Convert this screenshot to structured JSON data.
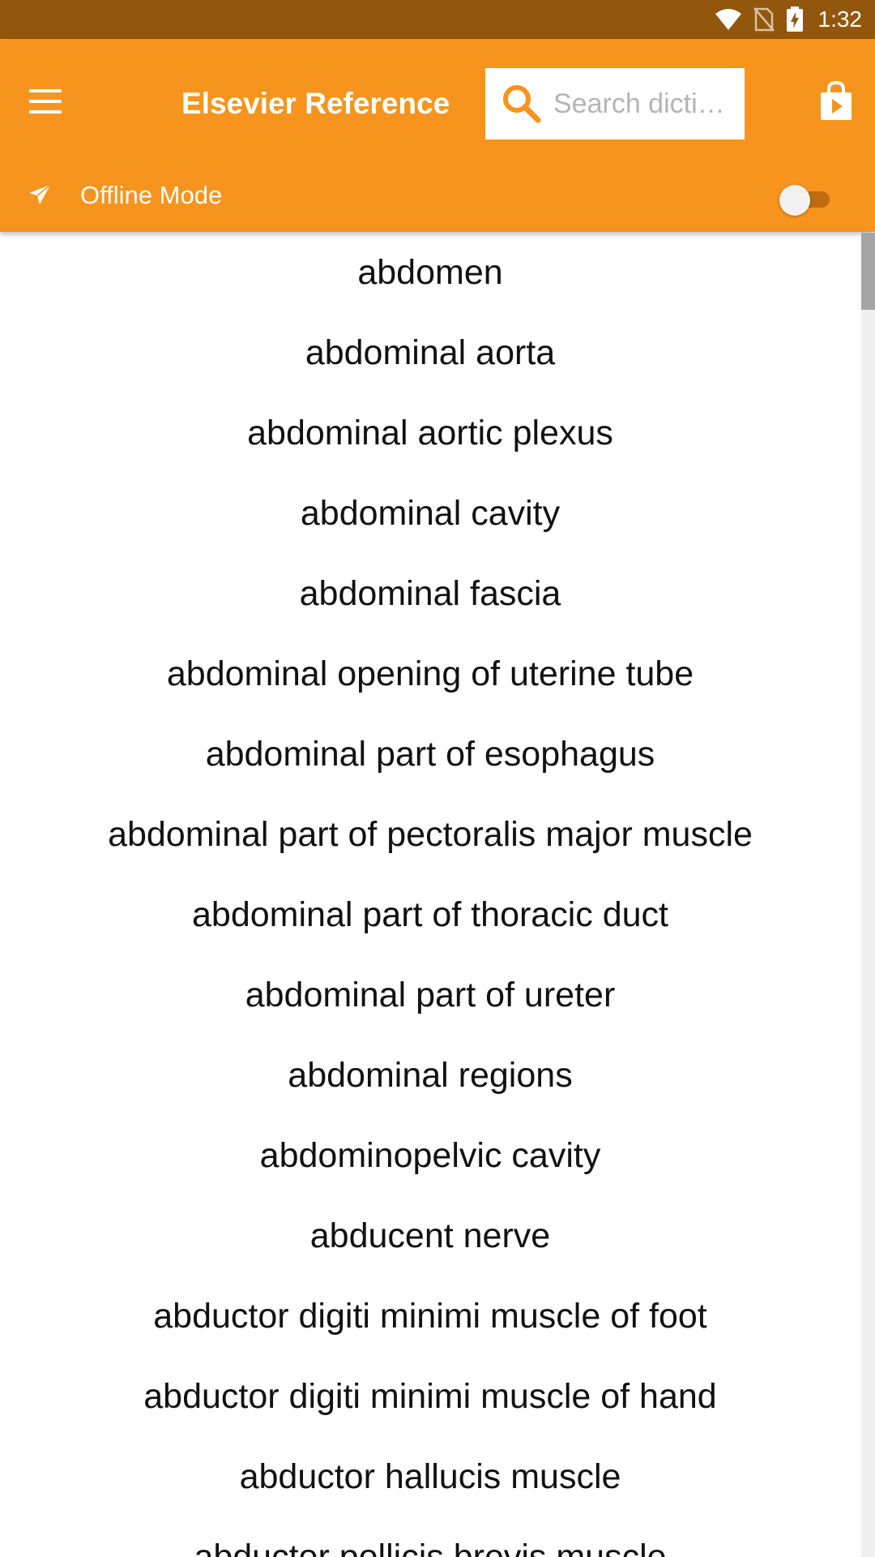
{
  "status_bar": {
    "time": "1:32",
    "icons": [
      "wifi-icon",
      "no-sim-icon",
      "battery-charging-icon"
    ]
  },
  "app_bar": {
    "title": "Elsevier Reference",
    "menu_icon": "hamburger-menu-icon",
    "search": {
      "placeholder": "Search dicti…",
      "value": "",
      "icon": "search-icon"
    },
    "store_icon": "shopping-bag-play-icon"
  },
  "offline": {
    "icon": "airplane-icon",
    "label": "Offline Mode",
    "enabled": false
  },
  "colors": {
    "status_bar": "#92570c",
    "app_bar": "#f7941d",
    "search_icon": "#f7941d",
    "text": "#111111"
  },
  "terms": [
    "abdomen",
    "abdominal aorta",
    "abdominal aortic plexus",
    "abdominal cavity",
    "abdominal fascia",
    "abdominal opening of uterine tube",
    "abdominal part of esophagus",
    "abdominal part of pectoralis major muscle",
    "abdominal part of thoracic duct",
    "abdominal part of ureter",
    "abdominal regions",
    "abdominopelvic cavity",
    "abducent nerve",
    "abductor digiti minimi muscle of foot",
    "abductor digiti minimi muscle of hand",
    "abductor hallucis muscle",
    "abductor pollicis brevis muscle"
  ]
}
